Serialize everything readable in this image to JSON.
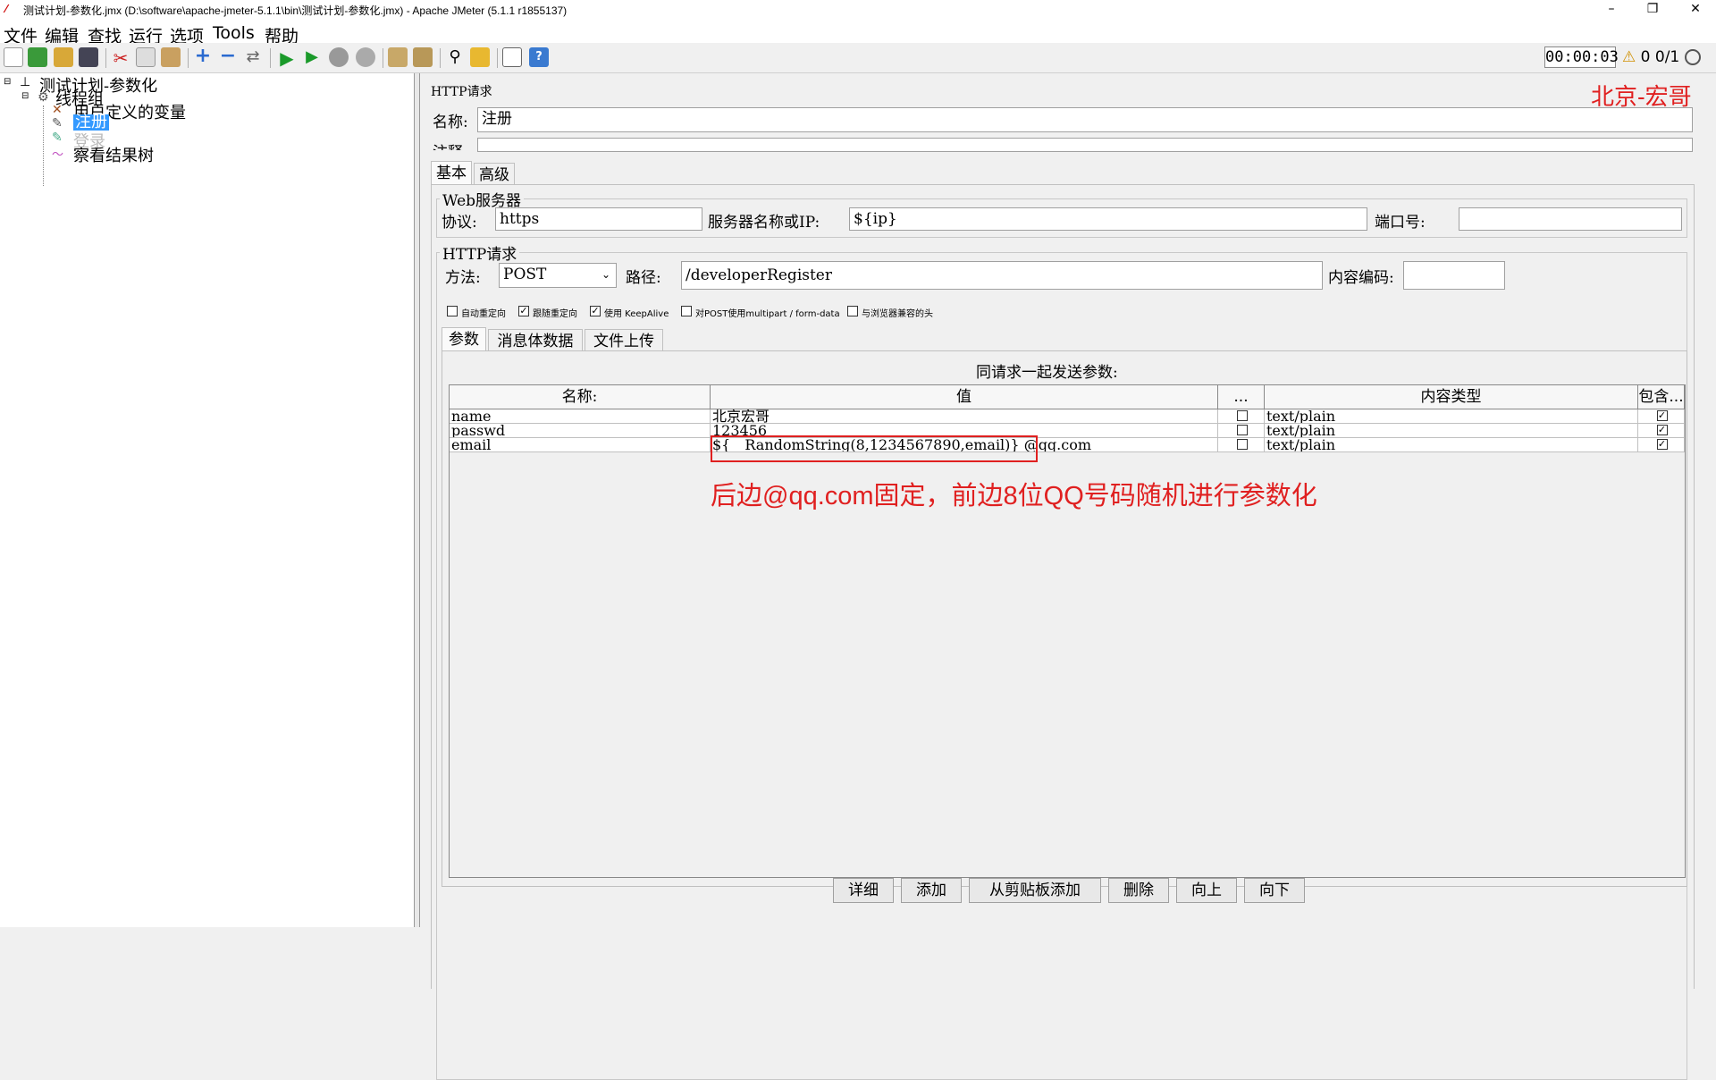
{
  "window": {
    "title": "测试计划-参数化.jmx (D:\\software\\apache-jmeter-5.1.1\\bin\\测试计划-参数化.jmx) - Apache JMeter (5.1.1 r1855137)",
    "minimize": "–",
    "restore": "❐",
    "close": "✕"
  },
  "menu": [
    "文件",
    "编辑",
    "查找",
    "运行",
    "选项",
    "Tools",
    "帮助"
  ],
  "toolbar": {
    "timer": "00:00:03",
    "warning_count": "0",
    "threads": "0/1"
  },
  "tree": {
    "root": "测试计划-参数化",
    "thread_group": "线程组",
    "items": [
      {
        "label": "用户定义的变量",
        "selected": false
      },
      {
        "label": "注册",
        "selected": true
      },
      {
        "label": "登录",
        "selected": false,
        "disabled": true
      },
      {
        "label": "察看结果树",
        "selected": false
      }
    ]
  },
  "watermark": "北京-宏哥",
  "panel": {
    "header": "HTTP请求",
    "name_label": "名称:",
    "name_value": "注册",
    "comment_label": "注释:",
    "tabs": [
      "基本",
      "高级"
    ],
    "web_server": {
      "legend": "Web服务器",
      "protocol_label": "协议:",
      "protocol_value": "https",
      "server_label": "服务器名称或IP:",
      "server_value": "${ip}",
      "port_label": "端口号:",
      "port_value": ""
    },
    "http_request": {
      "legend": "HTTP请求",
      "method_label": "方法:",
      "method_value": "POST",
      "path_label": "路径:",
      "path_value": "/developerRegister",
      "encoding_label": "内容编码:",
      "encoding_value": ""
    },
    "options": [
      {
        "label": "自动重定向",
        "checked": false
      },
      {
        "label": "跟随重定向",
        "checked": true
      },
      {
        "label": "使用 KeepAlive",
        "checked": true
      },
      {
        "label": "对POST使用multipart / form-data",
        "checked": false
      },
      {
        "label": "与浏览器兼容的头",
        "checked": false
      }
    ],
    "sub_tabs": [
      "参数",
      "消息体数据",
      "文件上传"
    ],
    "params_title": "同请求一起发送参数:",
    "columns": [
      "名称:",
      "值",
      "...",
      "内容类型",
      "包含..."
    ],
    "rows": [
      {
        "name": "name",
        "value": "北京宏哥",
        "encode": false,
        "content_type": "text/plain",
        "include": true
      },
      {
        "name": "passwd",
        "value": "123456",
        "encode": false,
        "content_type": "text/plain",
        "include": true
      },
      {
        "name": "email",
        "value": "${__RandomString(8,1234567890,email)}@qq.com",
        "encode": false,
        "content_type": "text/plain",
        "include": true
      }
    ],
    "email_value_parts": {
      "func": "${__RandomString(8,1234567890,email)}",
      "suffix": "@qq.com"
    },
    "annotation": "后边@qq.com固定，前边8位QQ号码随机进行参数化",
    "buttons": [
      "详细",
      "添加",
      "从剪贴板添加",
      "删除",
      "向上",
      "向下"
    ]
  },
  "colors": {
    "annotation": "#e02020",
    "watermark": "#e02020",
    "selection": "#3399ff"
  }
}
